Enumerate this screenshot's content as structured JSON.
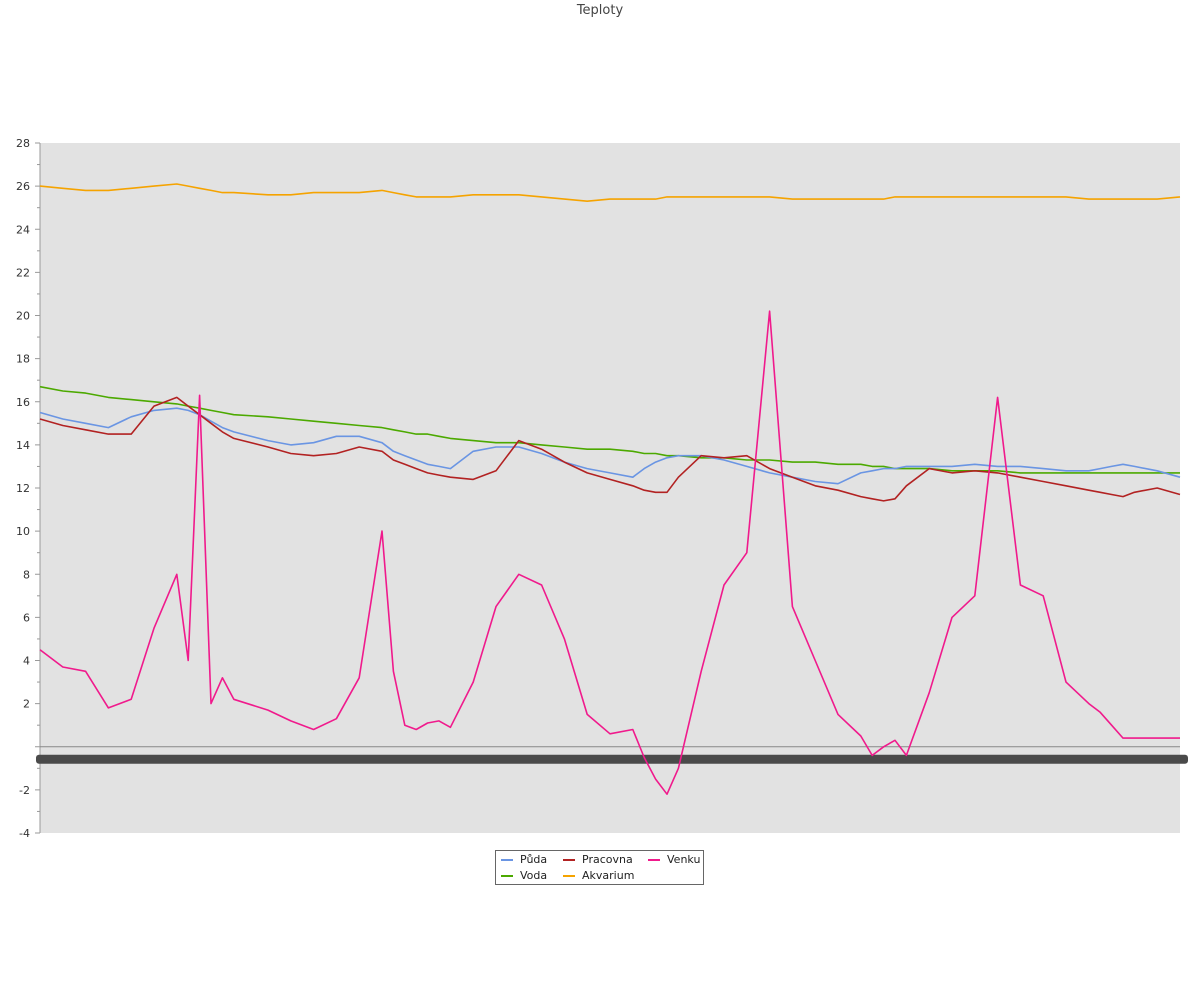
{
  "chart_data": {
    "type": "line",
    "title": "Teploty",
    "xlabel": "",
    "ylabel": "",
    "ylim": [
      -4,
      28
    ],
    "yticks": [
      -4,
      -2,
      2,
      4,
      6,
      8,
      10,
      12,
      14,
      16,
      18,
      20,
      22,
      24,
      26,
      28
    ],
    "x_ticks_note": "dense illegible tick labels",
    "grid": false,
    "legend": "bottom-center",
    "x": [
      0,
      0.02,
      0.04,
      0.06,
      0.08,
      0.1,
      0.12,
      0.13,
      0.14,
      0.15,
      0.16,
      0.17,
      0.2,
      0.22,
      0.24,
      0.26,
      0.28,
      0.3,
      0.31,
      0.32,
      0.33,
      0.34,
      0.35,
      0.36,
      0.38,
      0.4,
      0.42,
      0.44,
      0.46,
      0.48,
      0.5,
      0.52,
      0.53,
      0.54,
      0.55,
      0.56,
      0.58,
      0.6,
      0.62,
      0.64,
      0.66,
      0.68,
      0.7,
      0.72,
      0.73,
      0.74,
      0.75,
      0.76,
      0.78,
      0.8,
      0.82,
      0.84,
      0.86,
      0.88,
      0.9,
      0.92,
      0.93,
      0.94,
      0.95,
      0.96,
      0.98,
      1.0
    ],
    "series": [
      {
        "name": "Půda",
        "color": "#6a95e3",
        "values": [
          15.5,
          15.2,
          15.0,
          14.8,
          15.3,
          15.6,
          15.7,
          15.6,
          15.4,
          15.1,
          14.8,
          14.6,
          14.2,
          14.0,
          14.1,
          14.4,
          14.4,
          14.1,
          13.7,
          13.5,
          13.3,
          13.1,
          13.0,
          12.9,
          13.7,
          13.9,
          13.9,
          13.6,
          13.2,
          12.9,
          12.7,
          12.5,
          12.9,
          13.2,
          13.4,
          13.5,
          13.5,
          13.3,
          13.0,
          12.7,
          12.5,
          12.3,
          12.2,
          12.7,
          12.8,
          12.9,
          12.9,
          13.0,
          13.0,
          13.0,
          13.1,
          13.0,
          13.0,
          12.9,
          12.8,
          12.8,
          12.9,
          13.0,
          13.1,
          13.0,
          12.8,
          12.5
        ]
      },
      {
        "name": "Pracovna",
        "color": "#b22222",
        "values": [
          15.2,
          14.9,
          14.7,
          14.5,
          14.5,
          15.8,
          16.2,
          15.8,
          15.4,
          15.0,
          14.6,
          14.3,
          13.9,
          13.6,
          13.5,
          13.6,
          13.9,
          13.7,
          13.3,
          13.1,
          12.9,
          12.7,
          12.6,
          12.5,
          12.4,
          12.8,
          14.2,
          13.8,
          13.2,
          12.7,
          12.4,
          12.1,
          11.9,
          11.8,
          11.8,
          12.5,
          13.5,
          13.4,
          13.5,
          12.9,
          12.5,
          12.1,
          11.9,
          11.6,
          11.5,
          11.4,
          11.5,
          12.1,
          12.9,
          12.7,
          12.8,
          12.7,
          12.5,
          12.3,
          12.1,
          11.9,
          11.8,
          11.7,
          11.6,
          11.8,
          12.0,
          11.7
        ]
      },
      {
        "name": "Venku",
        "color": "#f01a8c",
        "values": [
          4.5,
          3.7,
          3.5,
          1.8,
          2.2,
          5.5,
          8.0,
          4.0,
          16.3,
          2.0,
          3.2,
          2.2,
          1.7,
          1.2,
          0.8,
          1.3,
          3.2,
          10.0,
          3.5,
          1.0,
          0.8,
          1.1,
          1.2,
          0.9,
          3.0,
          6.5,
          8.0,
          7.5,
          5.0,
          1.5,
          0.6,
          0.8,
          -0.5,
          -1.5,
          -2.2,
          -1.0,
          3.5,
          7.5,
          9.0,
          20.2,
          6.5,
          4.0,
          1.5,
          0.5,
          -0.4,
          0.0,
          0.3,
          -0.4,
          2.5,
          6.0,
          7.0,
          16.2,
          7.5,
          7.0,
          3.0,
          2.0,
          1.6,
          1.0,
          0.4,
          0.4,
          0.4,
          0.4
        ]
      },
      {
        "name": "Voda",
        "color": "#4ca900",
        "values": [
          16.7,
          16.5,
          16.4,
          16.2,
          16.1,
          16.0,
          15.9,
          15.8,
          15.7,
          15.6,
          15.5,
          15.4,
          15.3,
          15.2,
          15.1,
          15.0,
          14.9,
          14.8,
          14.7,
          14.6,
          14.5,
          14.5,
          14.4,
          14.3,
          14.2,
          14.1,
          14.1,
          14.0,
          13.9,
          13.8,
          13.8,
          13.7,
          13.6,
          13.6,
          13.5,
          13.5,
          13.4,
          13.4,
          13.3,
          13.3,
          13.2,
          13.2,
          13.1,
          13.1,
          13.0,
          13.0,
          12.9,
          12.9,
          12.9,
          12.8,
          12.8,
          12.8,
          12.7,
          12.7,
          12.7,
          12.7,
          12.7,
          12.7,
          12.7,
          12.7,
          12.7,
          12.7
        ]
      },
      {
        "name": "Akvarium",
        "color": "#f5a300",
        "values": [
          26.0,
          25.9,
          25.8,
          25.8,
          25.9,
          26.0,
          26.1,
          26.0,
          25.9,
          25.8,
          25.7,
          25.7,
          25.6,
          25.6,
          25.7,
          25.7,
          25.7,
          25.8,
          25.7,
          25.6,
          25.5,
          25.5,
          25.5,
          25.5,
          25.6,
          25.6,
          25.6,
          25.5,
          25.4,
          25.3,
          25.4,
          25.4,
          25.4,
          25.4,
          25.5,
          25.5,
          25.5,
          25.5,
          25.5,
          25.5,
          25.4,
          25.4,
          25.4,
          25.4,
          25.4,
          25.4,
          25.5,
          25.5,
          25.5,
          25.5,
          25.5,
          25.5,
          25.5,
          25.5,
          25.5,
          25.4,
          25.4,
          25.4,
          25.4,
          25.4,
          25.4,
          25.5
        ]
      }
    ]
  }
}
